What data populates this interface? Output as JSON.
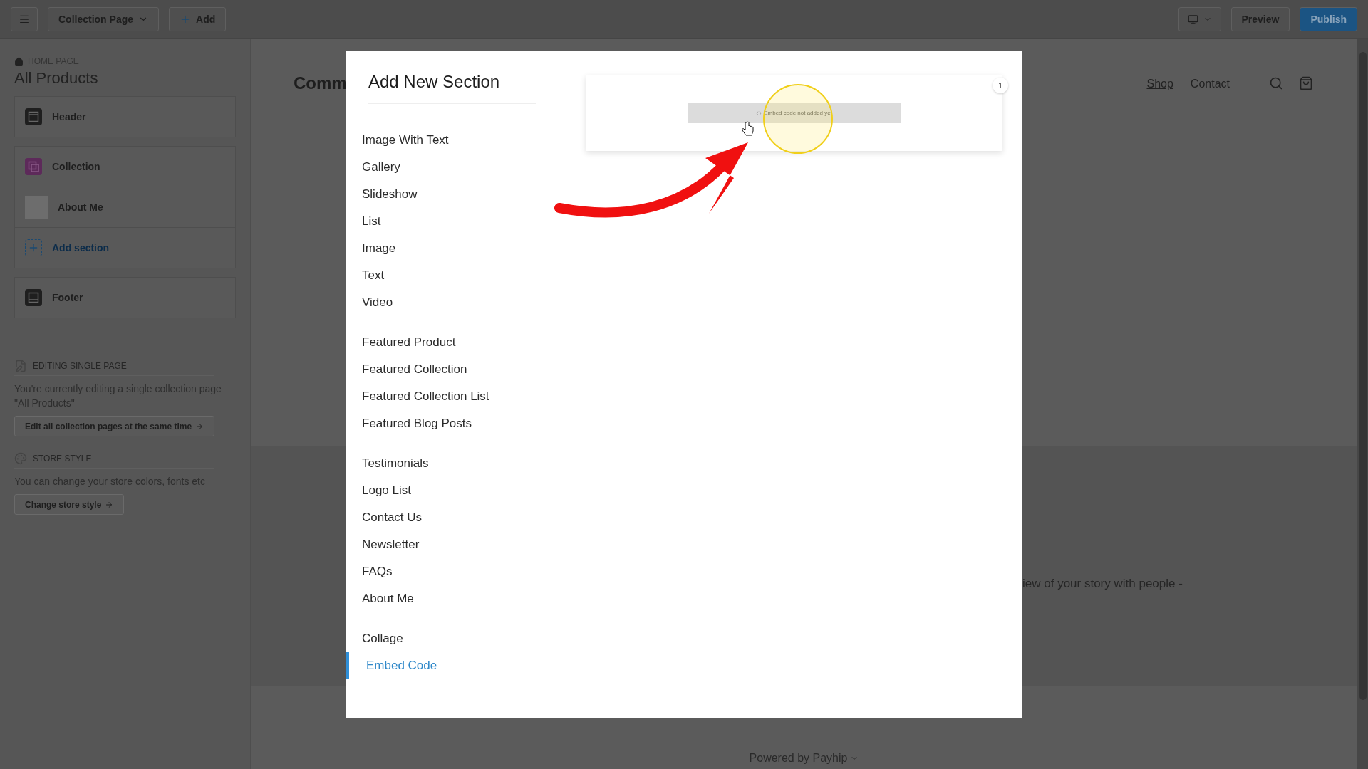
{
  "toolbar": {
    "page_selector": "Collection Page",
    "add_button": "Add",
    "preview_button": "Preview",
    "publish_button": "Publish"
  },
  "sidebar": {
    "breadcrumb": "HOME PAGE",
    "title": "All Products",
    "section_groups": [
      [
        {
          "label": "Header",
          "kind": "header"
        }
      ],
      [
        {
          "label": "Collection",
          "kind": "collection"
        },
        {
          "label": "About Me",
          "kind": "photo"
        },
        {
          "label": "Add section",
          "kind": "add"
        }
      ],
      [
        {
          "label": "Footer",
          "kind": "footer"
        }
      ]
    ],
    "info_blocks": [
      {
        "kind": "page",
        "heading": "EDITING SINGLE PAGE",
        "text": "You're currently editing a single collection page \"All Products\"",
        "button": "Edit all collection pages at the same time"
      },
      {
        "kind": "style",
        "heading": "STORE STYLE",
        "text": "You can change your store colors, fonts etc",
        "button": "Change store style"
      }
    ]
  },
  "store": {
    "title": "Comm",
    "nav": [
      {
        "label": "Shop",
        "selected": true
      },
      {
        "label": "Contact",
        "selected": false
      }
    ],
    "about_text": "iew of your story with people -",
    "footer": "Powered by Payhip"
  },
  "modal": {
    "title": "Add New Section",
    "groups": [
      [
        {
          "label": "Image With Text",
          "selected": false
        },
        {
          "label": "Gallery",
          "selected": false
        },
        {
          "label": "Slideshow",
          "selected": false
        },
        {
          "label": "List",
          "selected": false
        },
        {
          "label": "Image",
          "selected": false
        },
        {
          "label": "Text",
          "selected": false
        },
        {
          "label": "Video",
          "selected": false
        }
      ],
      [
        {
          "label": "Featured Product",
          "selected": false
        },
        {
          "label": "Featured Collection",
          "selected": false
        },
        {
          "label": "Featured Collection List",
          "selected": false
        },
        {
          "label": "Featured Blog Posts",
          "selected": false
        }
      ],
      [
        {
          "label": "Testimonials",
          "selected": false
        },
        {
          "label": "Logo List",
          "selected": false
        },
        {
          "label": "Contact Us",
          "selected": false
        },
        {
          "label": "Newsletter",
          "selected": false
        },
        {
          "label": "FAQs",
          "selected": false
        },
        {
          "label": "About Me",
          "selected": false
        }
      ],
      [
        {
          "label": "Collage",
          "selected": false
        },
        {
          "label": "Embed Code",
          "selected": true
        }
      ]
    ],
    "preview": {
      "badge": "1",
      "embed_text": "Embed code not added yet"
    }
  }
}
